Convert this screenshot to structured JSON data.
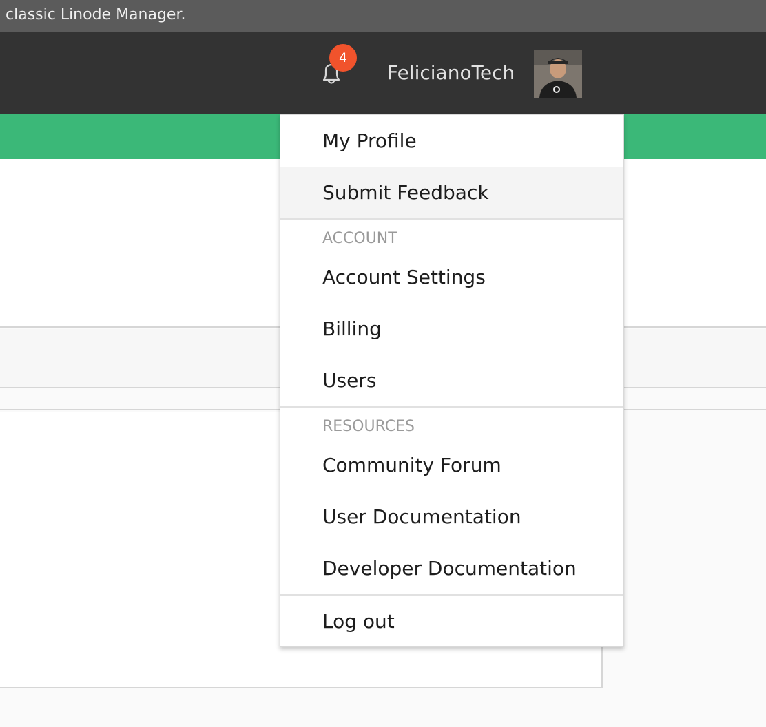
{
  "banner": {
    "text": "classic Linode Manager."
  },
  "header": {
    "notifications": {
      "icon": "bell-icon",
      "count": "4"
    },
    "username": "FelicianoTech",
    "avatar": "user-avatar"
  },
  "colors": {
    "header_bg": "#333333",
    "accent_green": "#3bb878",
    "badge_red": "#f1532c"
  },
  "menu": {
    "my_profile": "My Profile",
    "submit_feedback": "Submit Feedback",
    "account_section": "ACCOUNT",
    "account_settings": "Account Settings",
    "billing": "Billing",
    "users": "Users",
    "resources_section": "RESOURCES",
    "community_forum": "Community Forum",
    "user_documentation": "User Documentation",
    "developer_documentation": "Developer Documentation",
    "log_out": "Log out"
  }
}
